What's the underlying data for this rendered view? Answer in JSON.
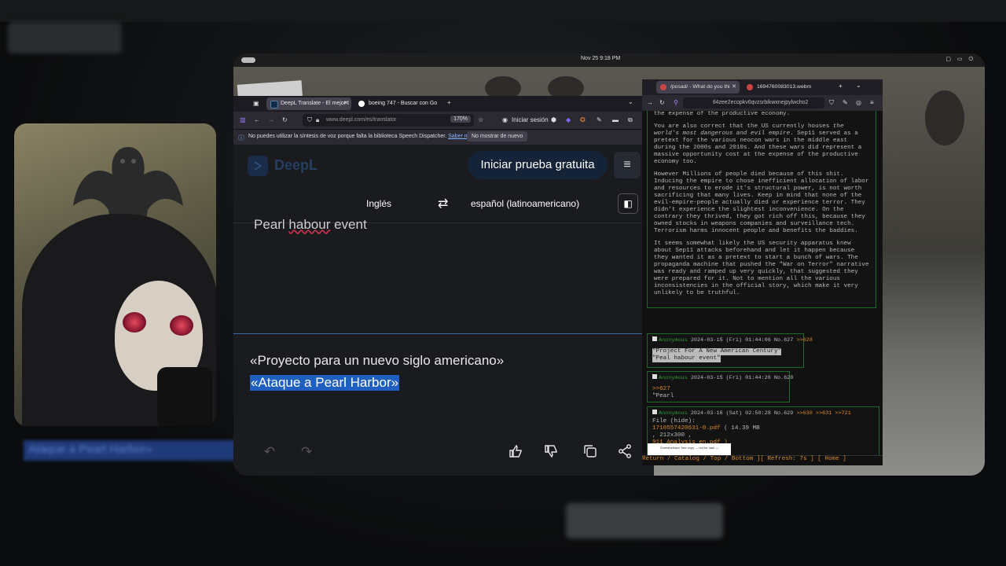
{
  "topbar": {
    "clock": "Nov 25  9:18 PM",
    "tray": "▢ ▭ ⏻"
  },
  "deepl_browser": {
    "tabs": [
      {
        "label": "DeepL Translate - El mejor t",
        "active": true,
        "fav_color": "#0f2b46"
      },
      {
        "label": "boeing 747 - Buscar con Go",
        "active": false,
        "fav_color": "#ffffff"
      }
    ],
    "new_tab": "+",
    "tab_list": "⌄",
    "url": "www.deepl.com/es/translator",
    "zoom": "170%",
    "login_label": "Iniciar sesión",
    "infobar": {
      "message": "No puedes utilizar la síntesis de voz porque falta la biblioteca Speech Dispatcher.",
      "more_link": "Saber más",
      "dismiss": "No mostrar de nuevo",
      "close": "✕"
    },
    "deepl": {
      "brand": "DeepL",
      "trial_button": "Iniciar prueba gratuita",
      "source_language": "Inglés",
      "target_language": "español (latinoamericano)",
      "source_text_prefix": "Pearl ",
      "source_text_misspelled": "habour",
      "source_text_suffix": " event",
      "target_line1": "«Proyecto para un nuevo siglo americano»",
      "target_line2": "«Ataque a Pearl Harbor»"
    }
  },
  "thread_browser": {
    "tabs": [
      {
        "label": "/posad/ - What do you thi"
      },
      {
        "label": "1694760083013.webm"
      }
    ],
    "url": "tl4zee2ecopkv6qvzsrbikwxnejpylwcho2",
    "main_post": {
      "p0": "the expense of the productive economy.",
      "p1a": "You are also correct that the US currently houses ",
      "p1b": "the world's most dangerous and evil empire",
      "p1c": ". Sep11 served as a pretext for the various neocon wars in the middle east during the 2000s and 2010s. And these wars did represent a massive opportunity cost at the expense of the productive economy too.",
      "p2": "However Millions of people died because of this shit. Inducing the empire to chose inefficient allocation of labor and resources to erode it's structural power, is not worth sacrificing that many lives. Keep in mind that none of the evil-empire-people actually died or experience terror. They didn't experience the slightest inconvenience. On the contrary they thrived, they got rich off this, because they owned stocks in weapons companies and surveillance tech. Terrorism harms innocent people and benefits the baddies.",
      "p3": "It seems somewhat likely the US security apparatus knew about Sep11 attacks beforehand and let it happen because they wanted it as a pretext to start a bunch of wars. The propaganda machine that pushed the  \"War on Terror\" narrative was ready and ramped up very quickly, that suggested they were prepared for it. Not to mention all the various inconsistencies in the official story, which make it very unlikely to be truthful."
    },
    "replies": [
      {
        "name": "Anonymous",
        "date": "2024-03-15 (Fri) 01:44:06 No.627",
        "backlinks": ">>628",
        "body1": "\"Project For A New American Century\"",
        "body2": "\"Peal habour event\""
      },
      {
        "name": "Anonymous",
        "date": "2024-03-15 (Fri) 01:44:26 No.628",
        "backlinks": "",
        "body1": ">>627",
        "body2": "\"Pearl"
      },
      {
        "name": "Anonymous",
        "date": "2024-03-16 (Sat) 02:50:28 No.629",
        "backlinks": ">>630 >>631 >>721",
        "file_label": "File (hide):",
        "file_name": "1710557420631-0.pdf",
        "file_size": "( 14.39 MB",
        "file_dims": ", 212x300 ,",
        "file_orig": "911_Analysis_en.pdf )",
        "thumb_text": "Overwhelmed, free copy — not for sale —"
      }
    ],
    "bottom_bar": "Return / Catalog / Top / Bottom ][ Refresh:   7s ]   [ Home ]"
  },
  "background": {
    "selected_text": "Ataque a Pearl Harbor»"
  }
}
